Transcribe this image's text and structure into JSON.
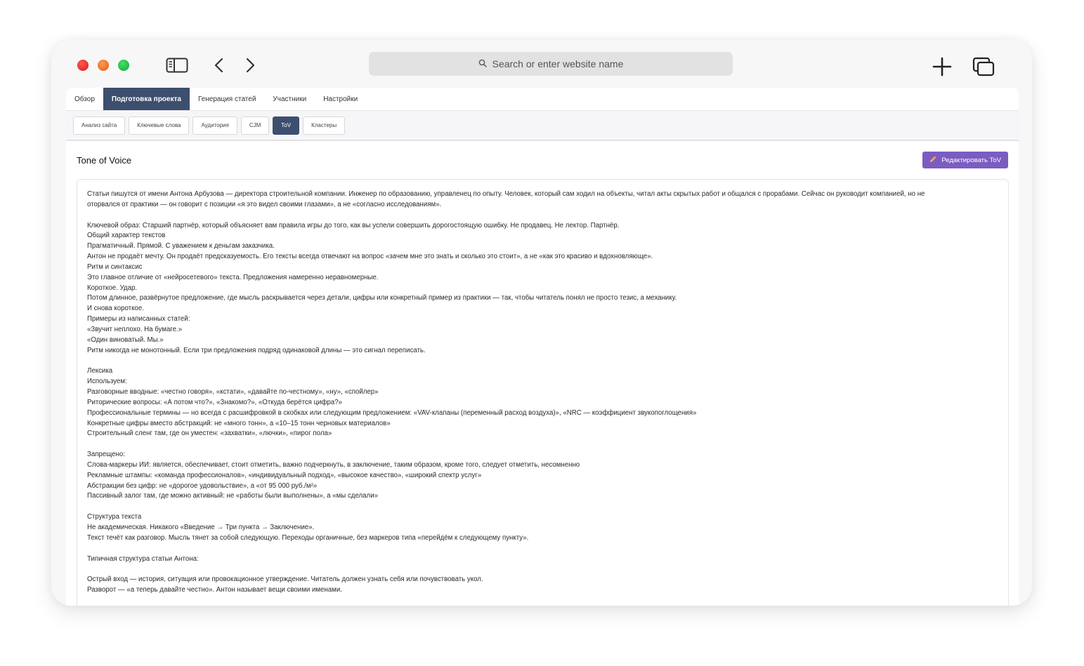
{
  "browser": {
    "address_placeholder": "Search or enter website name"
  },
  "main_tabs": [
    {
      "label": "Обзор",
      "active": false
    },
    {
      "label": "Подготовка проекта",
      "active": true
    },
    {
      "label": "Генерация статей",
      "active": false
    },
    {
      "label": "Участники",
      "active": false
    },
    {
      "label": "Настройки",
      "active": false
    }
  ],
  "sub_tabs": [
    {
      "label": "Анализ сайта",
      "active": false
    },
    {
      "label": "Ключевые слова",
      "active": false
    },
    {
      "label": "Аудитория",
      "active": false
    },
    {
      "label": "CJM",
      "active": false
    },
    {
      "label": "ToV",
      "active": true
    },
    {
      "label": "Кластеры",
      "active": false
    }
  ],
  "tov": {
    "title": "Tone of Voice",
    "edit_label": "Редактировать ToV",
    "lines": [
      "Статьи пишутся от имени Антона Арбузова — директора строительной компании. Инженер по образованию, управленец по опыту. Человек, который сам ходил на объекты, читал акты скрытых работ и общался с прорабами. Сейчас он руководит компанией, но не",
      "оторвался от практики — он говорит с позиции «я это видел своими глазами», а не «согласно исследованиям».",
      "",
      "Ключевой образ: Старший партнёр, который объясняет вам правила игры до того, как вы успели совершить дорогостоящую ошибку. Не продавец. Не лектор. Партнёр.",
      "Общий характер текстов",
      "Прагматичный. Прямой. С уважением к деньгам заказчика.",
      "Антон не продаёт мечту. Он продаёт предсказуемость. Его тексты всегда отвечают на вопрос «зачем мне это знать и сколько это стоит», а не «как это красиво и вдохновляюще».",
      "Ритм и синтаксис",
      "Это главное отличие от «нейросетевого» текста. Предложения намеренно неравномерные.",
      "Короткое. Удар.",
      "Потом длинное, развёрнутое предложение, где мысль раскрывается через детали, цифры или конкретный пример из практики — так, чтобы читатель понял не просто тезис, а механику.",
      "И снова короткое.",
      "Примеры из написанных статей:",
      "«Звучит неплохо. На бумаге.»",
      "«Один виноватый. Мы.»",
      "Ритм никогда не монотонный. Если три предложения подряд одинаковой длины — это сигнал переписать.",
      "",
      "Лексика",
      "Используем:",
      "Разговорные вводные: «честно говоря», «кстати», «давайте по-честному», «ну», «спойлер»",
      "Риторические вопросы: «А потом что?», «Знакомо?», «Откуда берётся цифра?»",
      "Профессиональные термины — но всегда с расшифровкой в скобках или следующим предложением: «VAV-клапаны (переменный расход воздуха)», «NRC — коэффициент звукопоглощения»",
      "Конкретные цифры вместо абстракций: не «много тонн», а «10–15 тонн черновых материалов»",
      "Строительный сленг там, где он уместен: «захватки», «лючки», «пирог пола»",
      "",
      "Запрещено:",
      "Слова-маркеры ИИ: является, обеспечивает, стоит отметить, важно подчеркнуть, в заключение, таким образом, кроме того, следует отметить, несомненно",
      "Рекламные штампы: «команда профессионалов», «индивидуальный подход», «высокое качество», «широкий спектр услуг»",
      "Абстракции без цифр: не «дорогое удовольствие», а «от 95 000 руб./м²»",
      "Пассивный залог там, где можно активный: не «работы были выполнены», а «мы сделали»",
      "",
      "Структура текста",
      "Не академическая. Никакого «Введение → Три пункта → Заключение».",
      "Текст течёт как разговор. Мысль тянет за собой следующую. Переходы органичные, без маркеров типа «перейдём к следующему пункту».",
      "",
      "Типичная структура статьи Антона:",
      "",
      "Острый вход — история, ситуация или провокационное утверждение. Читатель должен узнать себя или почувствовать укол.",
      "Разворот — «а теперь давайте честно». Антон называет вещи своими именами."
    ]
  }
}
